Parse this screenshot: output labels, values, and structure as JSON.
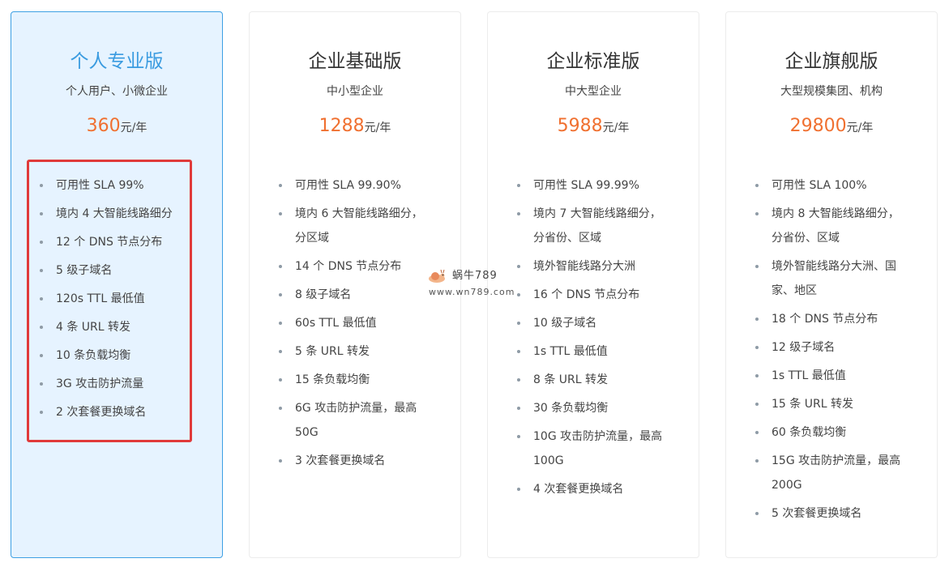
{
  "plans": [
    {
      "title": "个人专业版",
      "subtitle": "个人用户、小微企业",
      "price": "360",
      "unit": "元/年",
      "features": [
        "可用性 SLA 99%",
        "境内 4 大智能线路细分",
        "12 个 DNS 节点分布",
        "5 级子域名",
        "120s TTL 最低值",
        "4 条 URL 转发",
        "10 条负载均衡",
        "3G 攻击防护流量",
        "2 次套餐更换域名"
      ]
    },
    {
      "title": "企业基础版",
      "subtitle": "中小型企业",
      "price": "1288",
      "unit": "元/年",
      "features": [
        "可用性 SLA 99.90%",
        "境内 6 大智能线路细分，分区域",
        "14 个 DNS 节点分布",
        "8 级子域名",
        "60s TTL 最低值",
        "5 条 URL 转发",
        "15 条负载均衡",
        "6G 攻击防护流量，最高 50G",
        "3 次套餐更换域名"
      ]
    },
    {
      "title": "企业标准版",
      "subtitle": "中大型企业",
      "price": "5988",
      "unit": "元/年",
      "features": [
        "可用性 SLA 99.99%",
        "境内 7 大智能线路细分，分省份、区域",
        "境外智能线路分大洲",
        "16 个 DNS 节点分布",
        "10 级子域名",
        "1s TTL 最低值",
        "8 条 URL 转发",
        "30 条负载均衡",
        "10G 攻击防护流量，最高 100G",
        "4 次套餐更换域名"
      ]
    },
    {
      "title": "企业旗舰版",
      "subtitle": "大型规模集团、机构",
      "price": "29800",
      "unit": "元/年",
      "features": [
        "可用性 SLA 100%",
        "境内 8 大智能线路细分，分省份、区域",
        "境外智能线路分大洲、国家、地区",
        "18 个 DNS 节点分布",
        "12 级子域名",
        "1s TTL 最低值",
        "15 条 URL 转发",
        "60 条负载均衡",
        "15G 攻击防护流量，最高 200G",
        "5 次套餐更换域名"
      ]
    }
  ],
  "watermark": {
    "name": "蜗牛789",
    "url": "www.wn789.com"
  },
  "colors": {
    "accent": "#3a9be0",
    "price": "#f07030",
    "highlight": "#e03a3a",
    "active_bg": "#e6f3ff"
  }
}
